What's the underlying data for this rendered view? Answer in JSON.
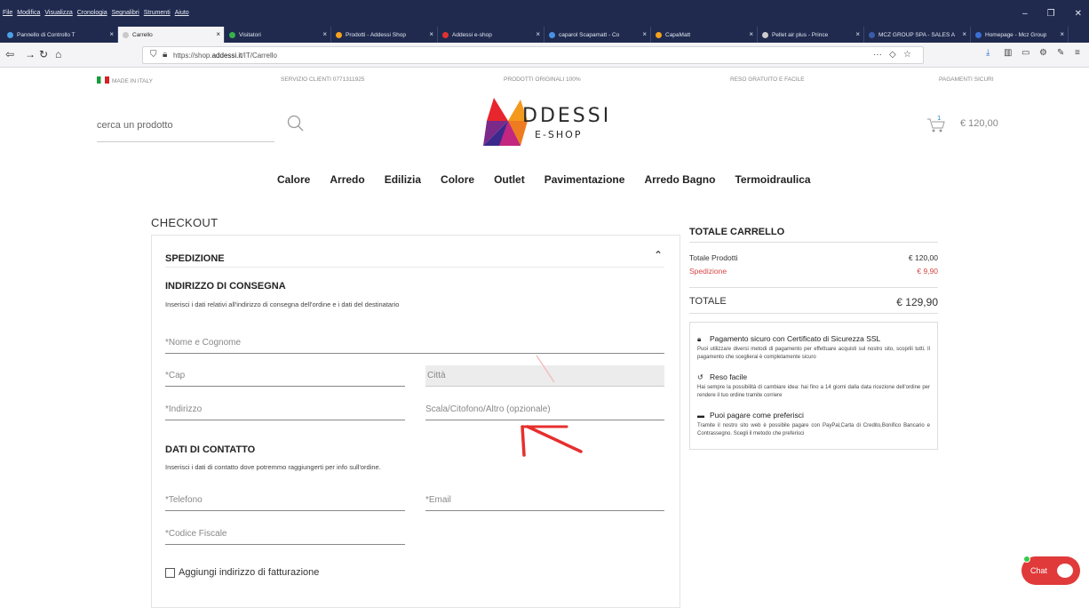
{
  "browser": {
    "menus": [
      "File",
      "Modifica",
      "Visualizza",
      "Cronologia",
      "Segnalibri",
      "Strumenti",
      "Aiuto"
    ],
    "tabs": [
      {
        "label": "Pannello di Controllo T",
        "color": "#4aa0e6",
        "active": false
      },
      {
        "label": "Carrello",
        "color": "#c9c9c9",
        "active": true
      },
      {
        "label": "Visitatori",
        "color": "#36b24a",
        "active": false
      },
      {
        "label": "Prodotti - Addessi Shop",
        "color": "#f7a21b",
        "active": false
      },
      {
        "label": "Addessi e-shop",
        "color": "#e33131",
        "active": false
      },
      {
        "label": "caparol Scapamatt - Co",
        "color": "#4a90e2",
        "active": false
      },
      {
        "label": "CapaMatt",
        "color": "#f7a21b",
        "active": false
      },
      {
        "label": "Pellet air plus - Prince",
        "color": "#cccccc",
        "active": false
      },
      {
        "label": "MCZ GROUP SPA - SALES A",
        "color": "#3b5ba8",
        "active": false
      },
      {
        "label": "Homepage - Mcz Group",
        "color": "#3b6fd4",
        "active": false
      }
    ],
    "url_prefix": "https://shop.",
    "url_domain": "addessi.it",
    "url_path": "/IT/Carrello",
    "url_more": "···"
  },
  "topstrip": {
    "made_in": "MADE IN ITALY",
    "service": "SERVIZIO CLIENTI 0771311925",
    "original": "PRODOTTI ORIGINALI 100%",
    "returns": "RESO GRATUITO E FACILE",
    "payments": "PAGAMENTI SICURI"
  },
  "header": {
    "search_placeholder": "cerca un prodotto",
    "logo_main": "DDESSI",
    "logo_sub": "E-SHOP",
    "cart_count": "1",
    "cart_total": "€ 120,00"
  },
  "nav": [
    "Calore",
    "Arredo",
    "Edilizia",
    "Colore",
    "Outlet",
    "Pavimentazione",
    "Arredo Bagno",
    "Termoidraulica"
  ],
  "checkout": {
    "title": "CHECKOUT",
    "shipping_title": "SPEDIZIONE",
    "address_title": "INDIRIZZO DI CONSEGNA",
    "address_desc": "Inserisci i dati relativi all'indirizzo di consegna dell'ordine e i dati del destinatario",
    "fields": {
      "name": "*Nome e Cognome",
      "cap": "*Cap",
      "city": "Città",
      "address": "*Indirizzo",
      "extra": "Scala/Citofono/Altro (opzionale)",
      "phone": "*Telefono",
      "email": "*Email",
      "tax_code": "*Codice Fiscale"
    },
    "contact_title": "DATI DI CONTATTO",
    "contact_desc": "Inserisci i dati di contatto dove potremmo raggiungerti per info sull'ordine.",
    "billing_label": "Aggiungi indirizzo di fatturazione"
  },
  "totals": {
    "title": "TOTALE CARRELLO",
    "products_label": "Totale Prodotti",
    "products_value": "€ 120,00",
    "shipping_label": "Spedizione",
    "shipping_value": "€ 9,90",
    "grand_label": "TOTALE",
    "grand_value": "€ 129,90",
    "ssl_title": "Pagamento sicuro con Certificato di Sicurezza SSL",
    "ssl_desc": "Puoi utilizzare diversi metodi di pagamento per effettuare acquisti sul nostro sito, scoprili tutti. Il pagamento che sceglierai è completamente sicuro",
    "return_title": "Reso facile",
    "return_desc": "Hai sempre la possibilità di cambiare idea: hai fino a 14 giorni dalla data ricezione dell'ordine per rendere il tuo ordine tramite corriere",
    "pay_title": "Puoi pagare come preferisci",
    "pay_desc": "Tramite il nostro sito web è possibile pagare con PayPal,Carta di Credito,Bonifico Bancario e Contrassegno. Scegli il metodo che preferisci"
  },
  "chat": {
    "label": "Chat"
  },
  "colors": {
    "accent_red": "#e03a3a",
    "shipping_red": "#d64545",
    "browser_dark": "#1f2a4e"
  }
}
